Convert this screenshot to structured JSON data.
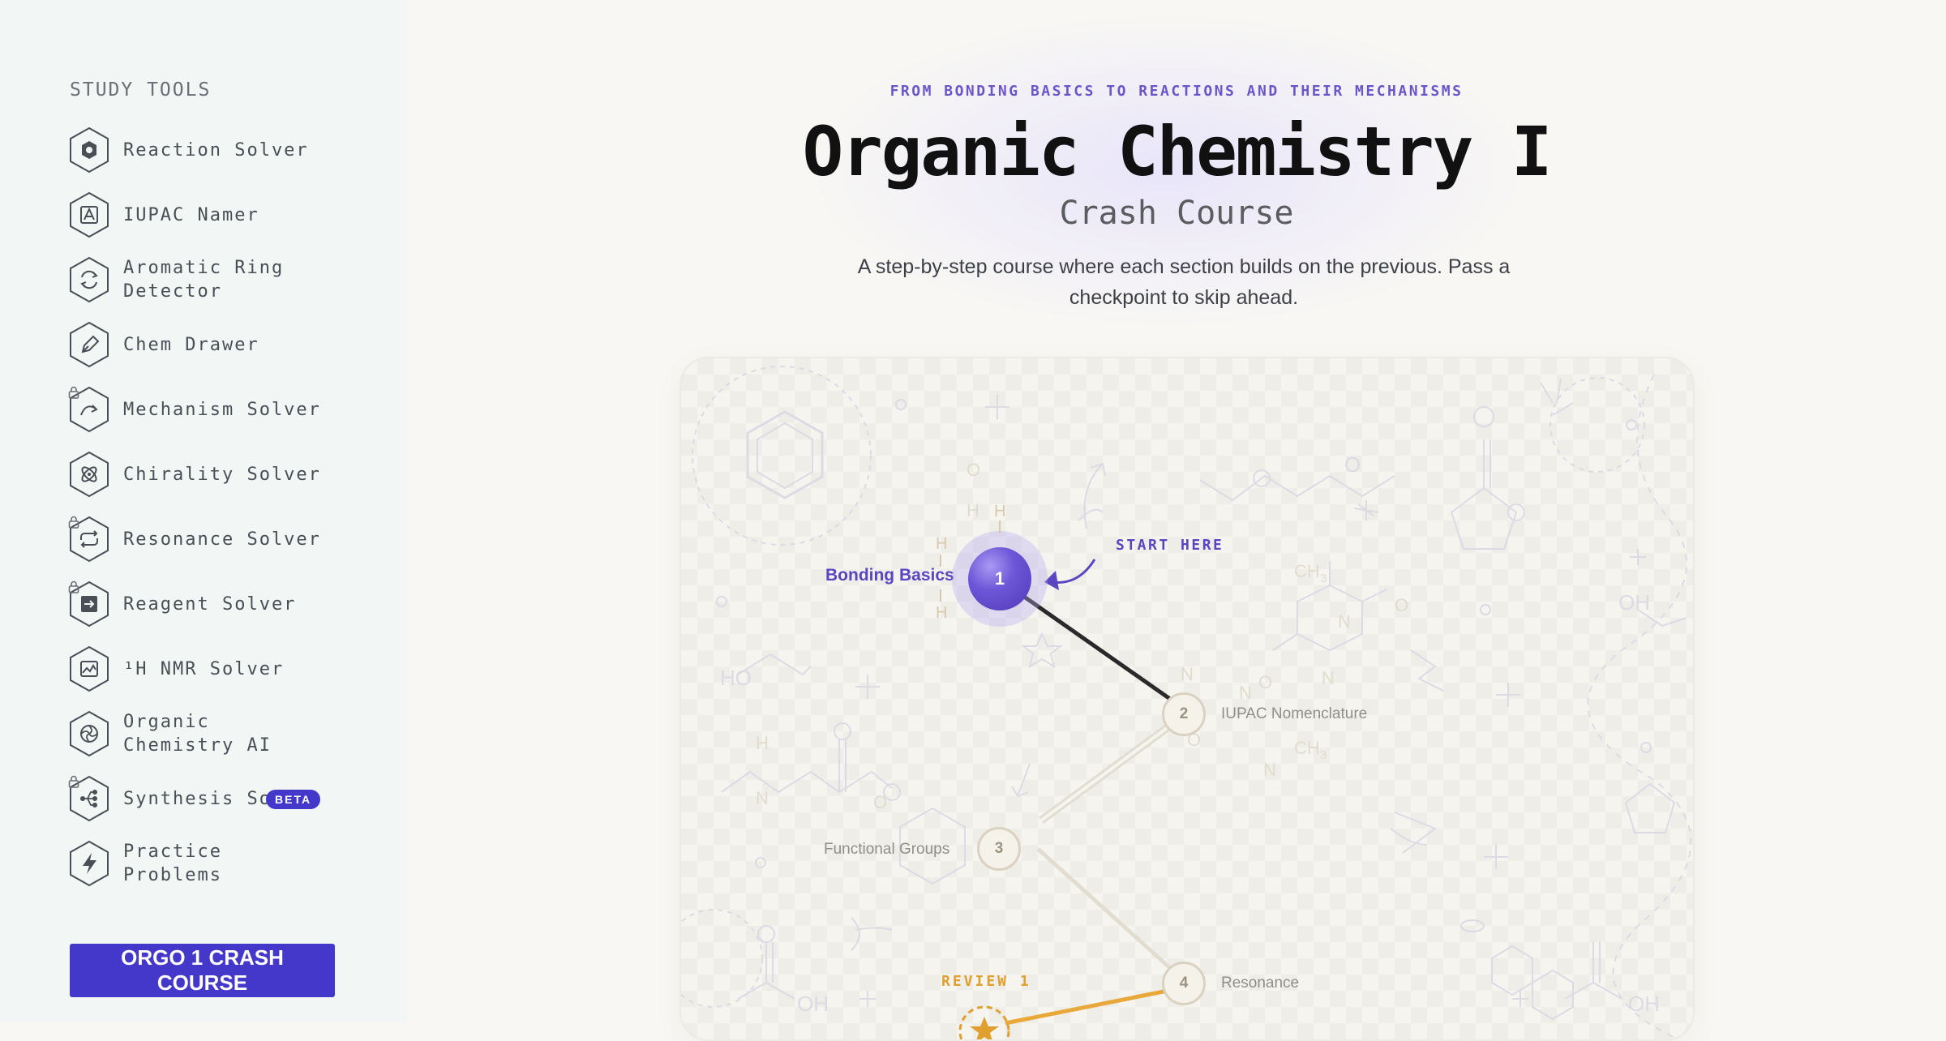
{
  "sidebar": {
    "title": "STUDY TOOLS",
    "items": [
      {
        "label": "Reaction Solver",
        "icon": "hexagon-icon",
        "locked": false
      },
      {
        "label": "IUPAC Namer",
        "icon": "letter-a-icon",
        "locked": false
      },
      {
        "label": "Aromatic Ring Detector",
        "icon": "refresh-icon",
        "locked": false
      },
      {
        "label": "Chem Drawer",
        "icon": "pen-icon",
        "locked": false
      },
      {
        "label": "Mechanism Solver",
        "icon": "curved-arrow-icon",
        "locked": true
      },
      {
        "label": "Chirality Solver",
        "icon": "atom-icon",
        "locked": false
      },
      {
        "label": "Resonance Solver",
        "icon": "cycle-arrows-icon",
        "locked": true
      },
      {
        "label": "Reagent Solver",
        "icon": "arrow-in-box-icon",
        "locked": true
      },
      {
        "label": "¹H NMR Solver",
        "icon": "spectrum-icon",
        "locked": false
      },
      {
        "label": "Organic Chemistry AI",
        "icon": "spiral-icon",
        "locked": false
      },
      {
        "label": "Synthesis Solver",
        "icon": "branch-icon",
        "locked": true,
        "badge": "BETA"
      },
      {
        "label": "Practice Problems",
        "icon": "lightning-icon",
        "locked": false
      }
    ],
    "cta": "ORGO 1 CRASH COURSE"
  },
  "header": {
    "eyebrow": "FROM BONDING BASICS TO REACTIONS AND THEIR MECHANISMS",
    "title": "Organic Chemistry I",
    "subtitle": "Crash Course",
    "description": "A step-by-step course where each section builds on the previous. Pass a checkpoint to skip ahead."
  },
  "path": {
    "start_label": "START HERE",
    "review_label": "REVIEW 1",
    "nodes": [
      {
        "number": "1",
        "label": "Bonding Basics",
        "state": "active"
      },
      {
        "number": "2",
        "label": "IUPAC Nomenclature",
        "state": "locked"
      },
      {
        "number": "3",
        "label": "Functional Groups",
        "state": "locked"
      },
      {
        "number": "4",
        "label": "Resonance",
        "state": "locked"
      }
    ]
  },
  "colors": {
    "accent": "#4338ca",
    "path_active": "#6e56d8",
    "review": "#e0a030"
  }
}
